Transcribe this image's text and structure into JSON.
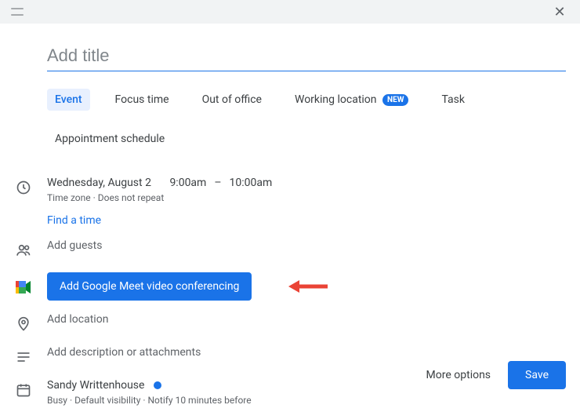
{
  "header": {
    "close_label": "✕"
  },
  "title": {
    "placeholder": "Add title",
    "value": ""
  },
  "tabs": {
    "event": "Event",
    "focus": "Focus time",
    "ooo": "Out of office",
    "location": "Working location",
    "location_badge": "NEW",
    "task": "Task",
    "appointment": "Appointment schedule"
  },
  "datetime": {
    "date": "Wednesday, August 2",
    "start": "9:00am",
    "sep": "–",
    "end": "10:00am",
    "tz": "Time zone",
    "repeat": "Does not repeat",
    "find": "Find a time"
  },
  "guests": {
    "placeholder": "Add guests"
  },
  "conferencing": {
    "button": "Add Google Meet video conferencing"
  },
  "location": {
    "placeholder": "Add location"
  },
  "description": {
    "placeholder": "Add description or attachments"
  },
  "calendar": {
    "owner": "Sandy Writtenhouse",
    "availability": "Busy",
    "visibility": "Default visibility",
    "notification": "Notify 10 minutes before"
  },
  "footer": {
    "more": "More options",
    "save": "Save"
  }
}
